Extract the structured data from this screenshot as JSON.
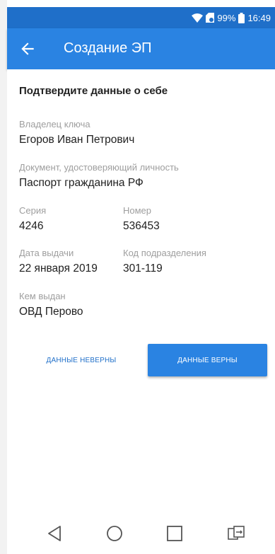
{
  "status_bar": {
    "battery": "99%",
    "time": "16:49"
  },
  "app_bar": {
    "title": "Создание ЭП"
  },
  "form": {
    "heading": "Подтвердите данные о себе",
    "owner_label": "Владелец ключа",
    "owner_value": "Егоров Иван Петрович",
    "doc_label": "Документ, удостоверяющий личность",
    "doc_value": "Паспорт гражданина РФ",
    "series_label": "Серия",
    "series_value": "4246",
    "number_label": "Номер",
    "number_value": "536453",
    "issue_date_label": "Дата выдачи",
    "issue_date_value": "22 января 2019",
    "dept_code_label": "Код подразделения",
    "dept_code_value": "301-119",
    "issued_by_label": "Кем выдан",
    "issued_by_value": "ОВД Перово"
  },
  "actions": {
    "wrong_label": "ДАННЫЕ НЕВЕРНЫ",
    "correct_label": "ДАННЫЕ ВЕРНЫ"
  },
  "colors": {
    "primary": "#2a83e2",
    "status": "#1f6fc9",
    "label": "#9e9e9e"
  },
  "icons": {
    "back": "arrow-left-icon",
    "wifi": "wifi-icon",
    "battery": "battery-icon",
    "nav_back": "triangle-back-icon",
    "nav_home": "circle-home-icon",
    "nav_recents": "square-recents-icon",
    "nav_switch": "dual-app-icon"
  }
}
